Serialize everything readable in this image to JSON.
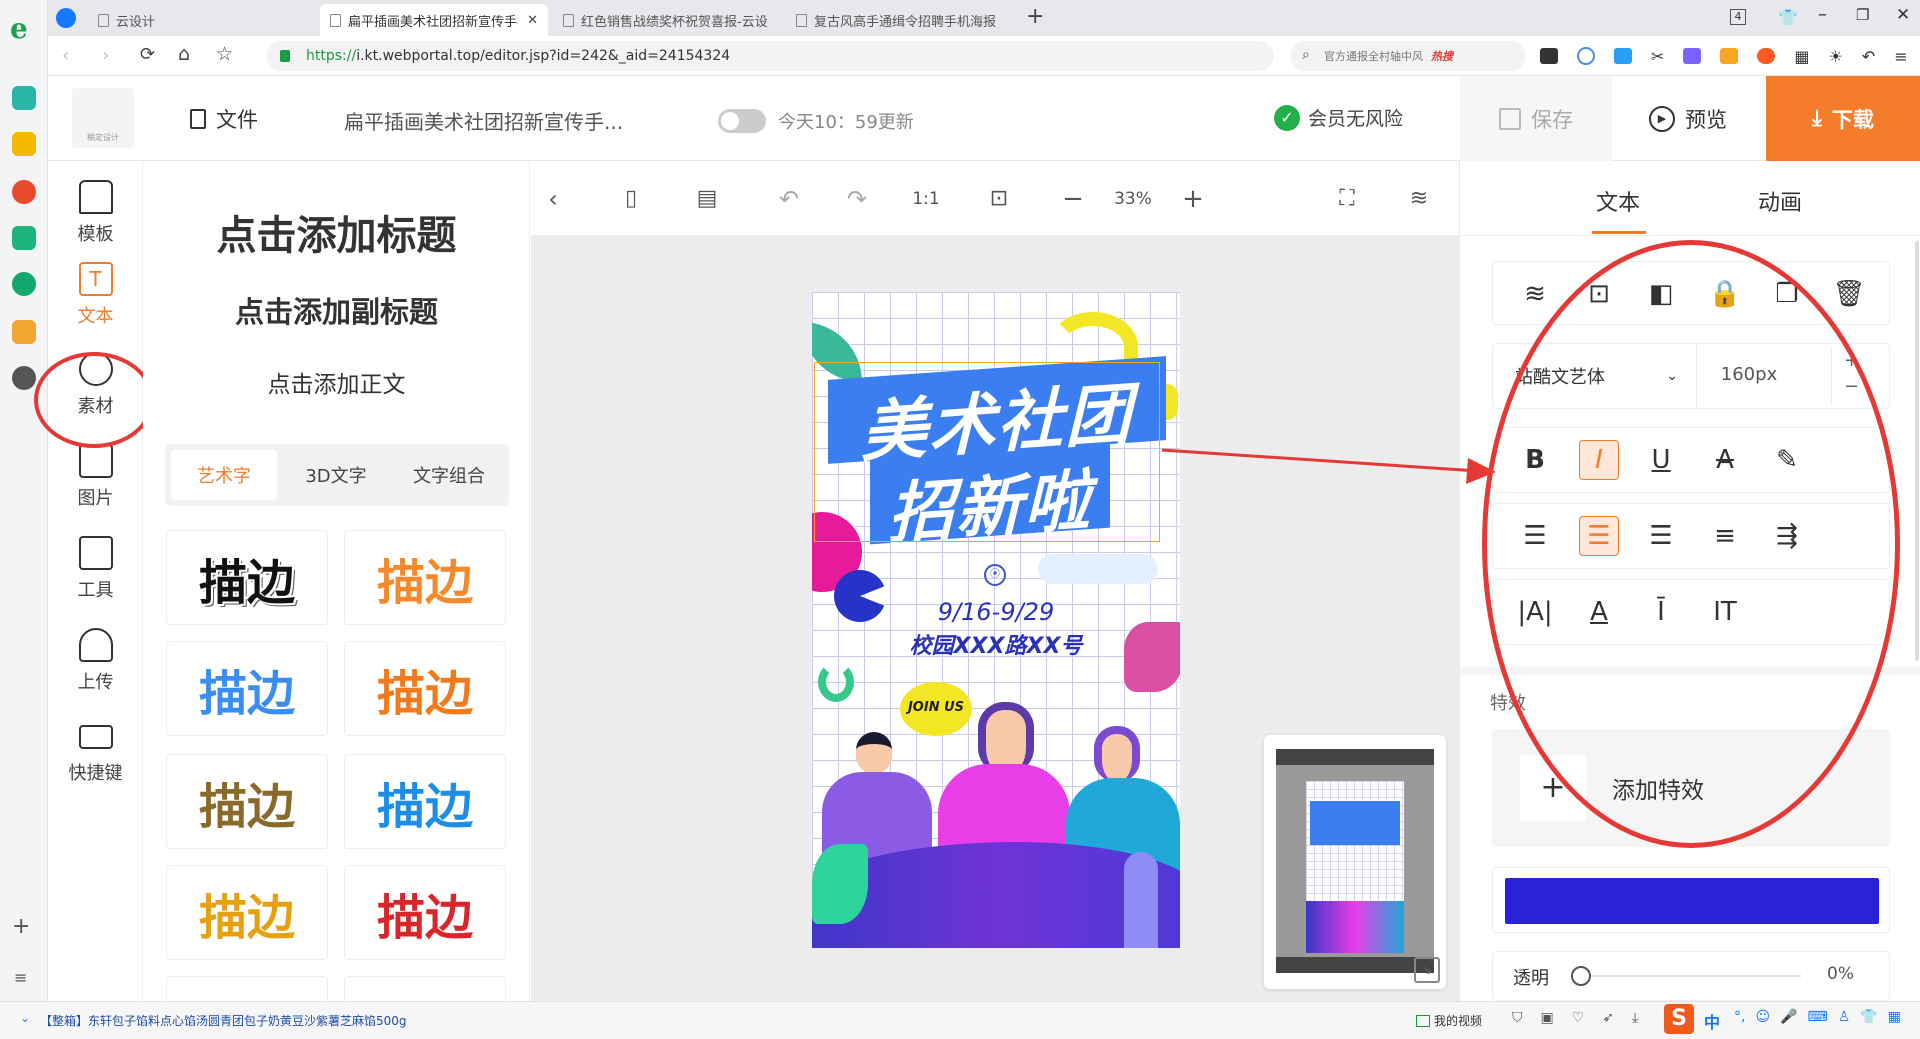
{
  "browser": {
    "tabs": [
      {
        "label": "云设计",
        "active": false
      },
      {
        "label": "扁平插画美术社团招新宣传手机",
        "active": true
      },
      {
        "label": "红色销售战绩奖杯祝贺喜报-云设",
        "active": false
      },
      {
        "label": "复古风高手通缉令招聘手机海报",
        "active": false
      }
    ],
    "new_tab": "+",
    "tab_count": "4",
    "url_scheme": "https://",
    "url_rest": "i.kt.webportal.top/editor.jsp?id=242&_aid=24154324",
    "search_text": "官方通报全村轴中风",
    "search_hot": "热搜"
  },
  "header": {
    "logo_text": "稿定设计",
    "file_label": "文件",
    "doc_title": "扁平插画美术社团招新宣传手...",
    "update_text": "今天10：59更新",
    "member_text": "会员无风险",
    "save_label": "保存",
    "preview_label": "预览",
    "download_label": "下载"
  },
  "sidebar": {
    "items": [
      {
        "label": "模板"
      },
      {
        "label": "文本"
      },
      {
        "label": "素材"
      },
      {
        "label": "图片"
      },
      {
        "label": "工具"
      },
      {
        "label": "上传"
      },
      {
        "label": "快捷键"
      }
    ],
    "add": "+",
    "menu": "≡"
  },
  "panel": {
    "add_title": "点击添加标题",
    "add_subtitle": "点击添加副标题",
    "add_body": "点击添加正文",
    "subtabs": [
      "艺术字",
      "3D文字",
      "文字组合"
    ],
    "tiles": [
      "描边",
      "描边",
      "描边",
      "描边",
      "描边",
      "描边",
      "描边",
      "描边"
    ]
  },
  "toolbar": {
    "ratio": "1:1",
    "zoom": "33%"
  },
  "poster": {
    "title_line1": "美术社团",
    "title_line2": "招新啦",
    "date": "9/16-9/29",
    "address": "校园XXX路XX号",
    "bubble": "JOIN US"
  },
  "rpanel": {
    "tab_text": "文本",
    "tab_anim": "动画",
    "font_name": "站酷文艺体",
    "font_size": "160px",
    "effects_label": "特效",
    "add_effect": "添加特效",
    "color": "#2a22d6",
    "opacity_label": "透明",
    "opacity_value": "0%"
  },
  "statusbar": {
    "news": "【整箱】东轩包子馅料点心馅汤圆青团包子奶黄豆沙紫薯芝麻馅500g",
    "video": "我的视频",
    "ime": "中"
  },
  "colors": {
    "accent": "#f07c2c",
    "annotation": "#e53935",
    "poster_blue": "#3b7ef0"
  }
}
